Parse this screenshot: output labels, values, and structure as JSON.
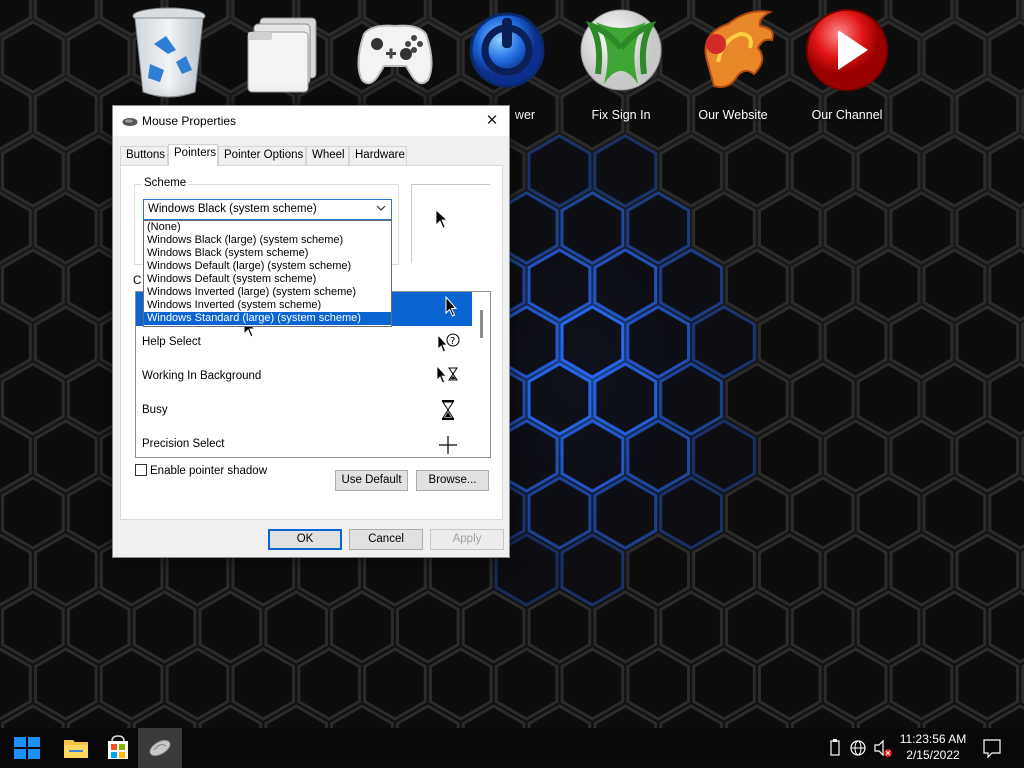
{
  "desktop": {
    "icons": [
      {
        "name": "recycle-bin",
        "label": ""
      },
      {
        "name": "files",
        "label": ""
      },
      {
        "name": "xbox-controller",
        "label": ""
      },
      {
        "name": "power",
        "label": "wer"
      },
      {
        "name": "fix-sign-in",
        "label": "Fix Sign In"
      },
      {
        "name": "our-website",
        "label": "Our Website"
      },
      {
        "name": "our-channel",
        "label": "Our Channel"
      }
    ]
  },
  "dialog": {
    "title": "Mouse Properties",
    "close_glyph": "✕",
    "tabs": [
      "Buttons",
      "Pointers",
      "Pointer Options",
      "Wheel",
      "Hardware"
    ],
    "active_tab": "Pointers",
    "scheme_label": "Scheme",
    "scheme_value": "Windows Black (system scheme)",
    "scheme_options": [
      "(None)",
      "Windows Black (large) (system scheme)",
      "Windows Black (system scheme)",
      "Windows Default (large) (system scheme)",
      "Windows Default (system scheme)",
      "Windows Inverted (large) (system scheme)",
      "Windows Inverted (system scheme)",
      "Windows Standard (large) (system scheme)"
    ],
    "highlighted_option": "Windows Standard (large) (system scheme)",
    "customize_label": "C",
    "cursor_rows": [
      {
        "label": "",
        "icon": "normal-select-icon",
        "selected": true
      },
      {
        "label": "Help Select",
        "icon": "help-select-icon",
        "selected": false
      },
      {
        "label": "Working In Background",
        "icon": "working-background-icon",
        "selected": false
      },
      {
        "label": "Busy",
        "icon": "busy-hourglass-icon",
        "selected": false
      },
      {
        "label": "Precision Select",
        "icon": "crosshair-icon",
        "selected": false
      }
    ],
    "enable_shadow_label": "Enable pointer shadow",
    "enable_shadow_checked": false,
    "use_default_label": "Use Default",
    "browse_label": "Browse...",
    "ok_label": "OK",
    "cancel_label": "Cancel",
    "apply_label": "Apply"
  },
  "taskbar": {
    "time": "11:23:56 AM",
    "date": "2/15/2022"
  },
  "colors": {
    "accent": "#0a64d2",
    "desktop_glow": "#2a6dff"
  }
}
